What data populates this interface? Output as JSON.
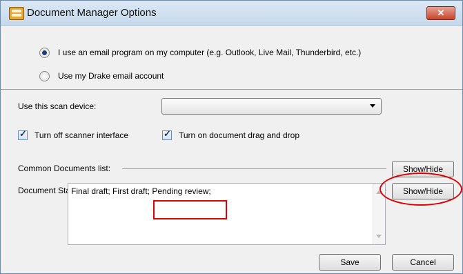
{
  "window": {
    "title": "Document Manager Options",
    "app_icon": "document-manager-icon",
    "close_icon": "close-icon",
    "close_label": "✕"
  },
  "email": {
    "option_computer": "I use an email program on my computer (e.g. Outlook, Live Mail, Thunderbird, etc.)",
    "option_drake": "Use my Drake email account",
    "selected": "computer"
  },
  "scan": {
    "label": "Use this scan device:",
    "selected_value": ""
  },
  "checkboxes": {
    "scanner_interface": {
      "label": "Turn off scanner interface",
      "checked": true
    },
    "drag_drop": {
      "label": "Turn on document drag and drop",
      "checked": true
    }
  },
  "lists": {
    "common_label": "Common Documents list:",
    "status_label": "Document Status list:",
    "show_hide_label": "Show/Hide",
    "status_text_before": "Final draft; First draft; ",
    "status_text_highlight": "Pending review;"
  },
  "buttons": {
    "save": "Save",
    "cancel": "Cancel"
  },
  "colors": {
    "annotation": "#e00000",
    "title_gradient_top": "#dbe8f5",
    "close_button": "#c8452e"
  }
}
